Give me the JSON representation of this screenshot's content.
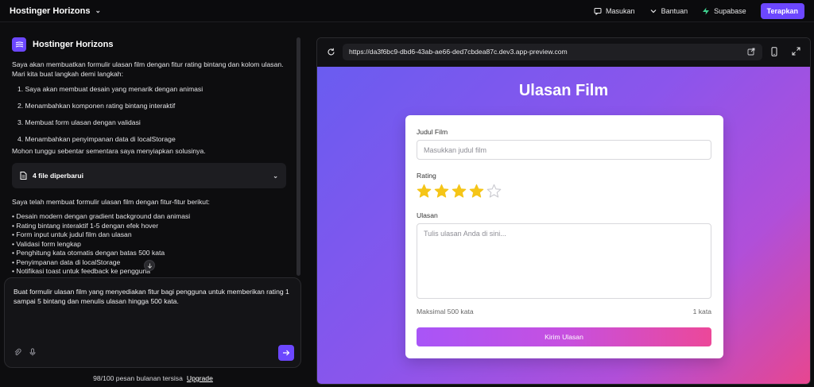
{
  "topbar": {
    "app_name": "Hostinger Horizons",
    "feedback": "Masukan",
    "help": "Bantuan",
    "supabase": "Supabase",
    "deploy": "Terapkan"
  },
  "chat": {
    "assistant_name": "Hostinger Horizons",
    "intro": "Saya akan membuatkan formulir ulasan film dengan fitur rating bintang dan kolom ulasan. Mari kita buat langkah demi langkah:",
    "steps": [
      "1. Saya akan membuat desain yang menarik dengan animasi",
      "2. Menambahkan komponen rating bintang interaktif",
      "3. Membuat form ulasan dengan validasi",
      "4. Menambahkan penyimpanan data di localStorage"
    ],
    "wait": "Mohon tunggu sebentar sementara saya menyiapkan solusinya.",
    "files_updated": "4 file diperbarui",
    "summary": "Saya telah membuat formulir ulasan film dengan fitur-fitur berikut:",
    "features": [
      "• Desain modern dengan gradient background dan animasi",
      "• Rating bintang interaktif 1-5 dengan efek hover",
      "• Form input untuk judul film dan ulasan",
      "• Validasi form lengkap",
      "• Penghitung kata otomatis dengan batas 500 kata",
      "• Penyimpanan data di localStorage",
      "• Notifikasi toast untuk feedback ke pengguna"
    ],
    "input_value": "Buat formulir ulasan film yang menyediakan fitur bagi pengguna untuk memberikan rating 1 sampai 5 bintang dan menulis ulasan hingga 500 kata.",
    "quota": "98/100 pesan bulanan tersisa",
    "upgrade": "Upgrade"
  },
  "preview": {
    "url": "https://da3f6bc9-dbd6-43ab-ae66-ded7cbdea87c.dev3.app-preview.com",
    "page_title": "Ulasan Film",
    "title_label": "Judul Film",
    "title_placeholder": "Masukkan judul film",
    "rating_label": "Rating",
    "rating": 4,
    "rating_max": 5,
    "review_label": "Ulasan",
    "review_placeholder": "Tulis ulasan Anda di sini...",
    "limit_text": "Maksimal 500 kata",
    "word_count": "1 kata",
    "submit": "Kirim Ulasan"
  },
  "colors": {
    "accent": "#6c47ff",
    "star_filled": "#f5c518",
    "star_empty": "#c9c9cf"
  }
}
